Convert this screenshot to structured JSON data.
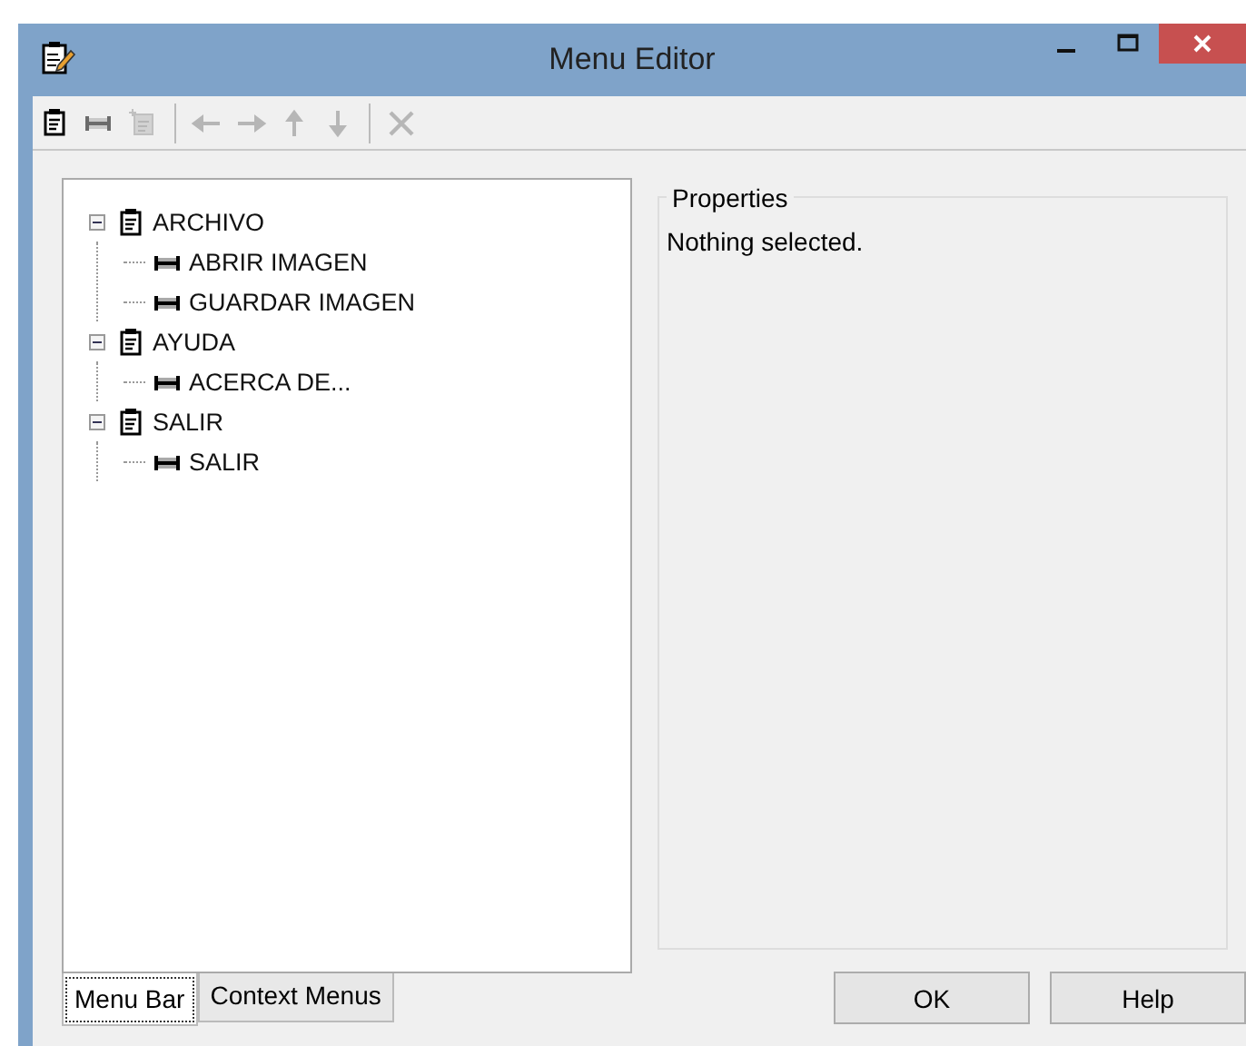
{
  "window": {
    "title": "Menu Editor"
  },
  "toolbar": [
    {
      "kind": "menu",
      "disabled": false
    },
    {
      "kind": "item",
      "disabled": true
    },
    {
      "kind": "insert",
      "disabled": true
    },
    {
      "kind": "sep"
    },
    {
      "kind": "left",
      "disabled": true
    },
    {
      "kind": "right",
      "disabled": true
    },
    {
      "kind": "up",
      "disabled": true
    },
    {
      "kind": "down",
      "disabled": true
    },
    {
      "kind": "sep"
    },
    {
      "kind": "delete",
      "disabled": true
    }
  ],
  "tree": [
    {
      "label": "ARCHIVO",
      "kind": "menu",
      "expanded": true,
      "children": [
        {
          "label": "ABRIR IMAGEN",
          "kind": "item"
        },
        {
          "label": "GUARDAR IMAGEN",
          "kind": "item"
        }
      ]
    },
    {
      "label": "AYUDA",
      "kind": "menu",
      "expanded": true,
      "children": [
        {
          "label": "ACERCA DE...",
          "kind": "item"
        }
      ]
    },
    {
      "label": "SALIR",
      "kind": "menu",
      "expanded": true,
      "children": [
        {
          "label": "SALIR",
          "kind": "item"
        }
      ]
    }
  ],
  "tabs": [
    {
      "label": "Menu Bar",
      "selected": true
    },
    {
      "label": "Context Menus",
      "selected": false
    }
  ],
  "properties": {
    "title": "Properties",
    "text": "Nothing selected."
  },
  "buttons": [
    "OK",
    "Help"
  ]
}
